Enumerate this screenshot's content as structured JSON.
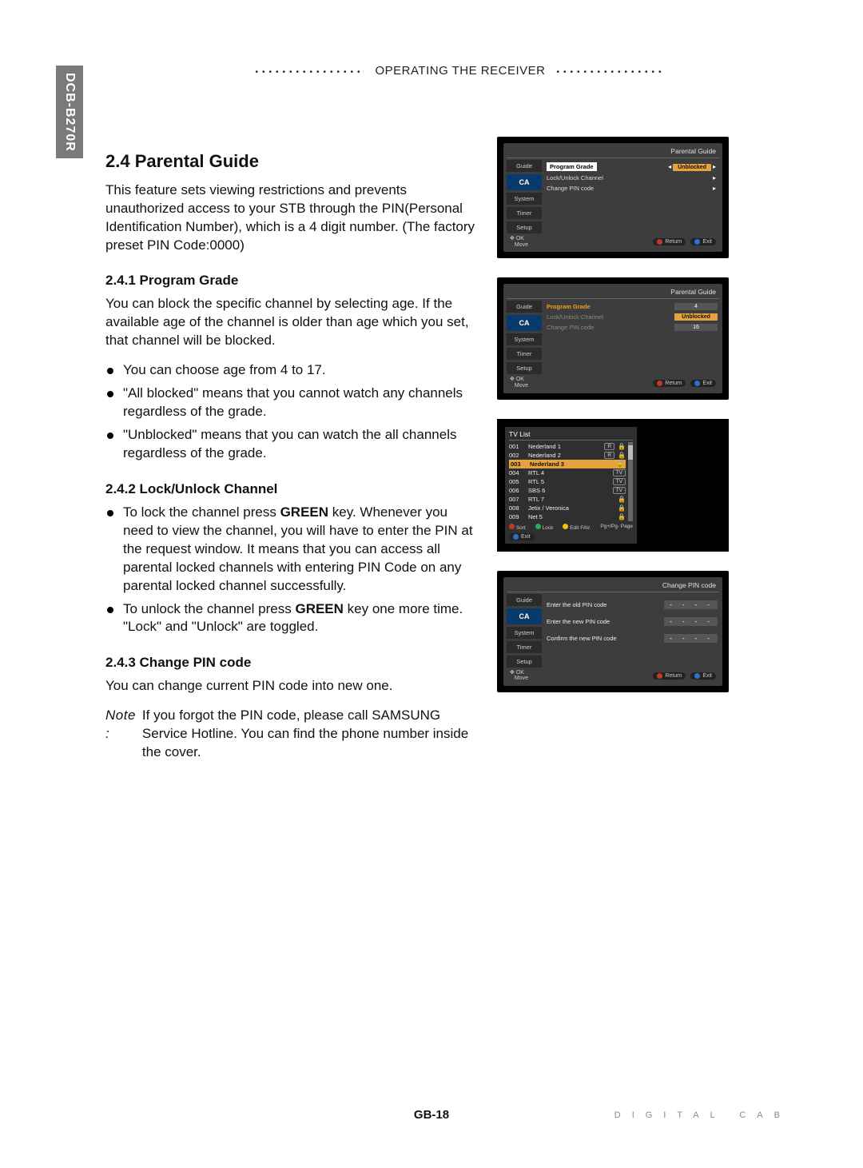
{
  "sideTab": "DCB-B270R",
  "headerTitle": "OPERATING THE RECEIVER",
  "section": {
    "title": "2.4 Parental Guide",
    "intro": "This feature sets viewing restrictions and prevents unauthorized access to your STB through the PIN(Personal Identification Number), which is a 4 digit number. (The factory preset PIN Code:0000)",
    "s1": {
      "title": "2.4.1 Program Grade",
      "p1": "You can block the specific channel by selecting age. If the available age of the channel is older than age which you set, that channel will be blocked.",
      "b1": "You can choose age from 4 to 17.",
      "b2": "\"All blocked\" means that you cannot watch any channels regardless of the grade.",
      "b3": "\"Unblocked\" means that you can watch the all channels regardless of the grade."
    },
    "s2": {
      "title": "2.4.2 Lock/Unlock Channel",
      "b1a": "To lock the channel press ",
      "b1key": "GREEN",
      "b1b": " key. Whenever you need to view the channel, you will have to enter the PIN at the request window. It means that you can access all parental locked channels with entering PIN Code on any parental locked channel successfully.",
      "b2a": "To unlock the channel press ",
      "b2key": "GREEN",
      "b2b": " key one more time. \"Lock\" and \"Unlock\" are toggled."
    },
    "s3": {
      "title": "2.4.3 Change PIN code",
      "p1": "You can change current PIN code into new one.",
      "noteLabel": "Note :",
      "noteText": "If you forgot the PIN code, please call SAMSUNG Service Hotline. You can find the phone number inside the cover."
    }
  },
  "footer": {
    "page": "GB-18",
    "brand": "DIGITAL CAB"
  },
  "shot1": {
    "title": "Parental Guide",
    "tabs": {
      "guide": "Guide",
      "ca": "CA",
      "system": "System",
      "timer": "Timer",
      "setup": "Setup"
    },
    "rows": {
      "r1l": "Program Grade",
      "r1v": "Unblocked",
      "r2l": "Lock/Unlock Channel",
      "r3l": "Change PIN code"
    },
    "ok": "OK",
    "move": "Move",
    "ret": "Return",
    "exit": "Exit"
  },
  "shot2": {
    "title": "Parental Guide",
    "rows": {
      "r1l": "Program Grade",
      "r1v": "4",
      "r2l": "Lock/Unlock Channel",
      "r2v": "Unblocked",
      "r3l": "Change PIN code",
      "r3v": "16"
    }
  },
  "shot3": {
    "title": "TV List",
    "rows": [
      {
        "n": "001",
        "name": "Nederland 1",
        "tag": "R",
        "lock": true
      },
      {
        "n": "002",
        "name": "Nederland 2",
        "tag": "R",
        "lock": true
      },
      {
        "n": "003",
        "name": "Nederland 3",
        "tag": "",
        "lock": true,
        "sel": true
      },
      {
        "n": "004",
        "name": "RTL 4",
        "tag": "TV",
        "lock": false
      },
      {
        "n": "005",
        "name": "RTL 5",
        "tag": "TV",
        "lock": false
      },
      {
        "n": "006",
        "name": "SBS 6",
        "tag": "TV",
        "lock": false
      },
      {
        "n": "007",
        "name": "RTL 7",
        "tag": "",
        "lock": true
      },
      {
        "n": "008",
        "name": "Jetix / Veronica",
        "tag": "",
        "lock": true
      },
      {
        "n": "009",
        "name": "Net 5",
        "tag": "",
        "lock": true
      }
    ],
    "sort": "Sort",
    "lock": "Lock",
    "edit": "Edit FAV.",
    "page": "Page",
    "exit": "Exit",
    "pginfo": "Pg+/Pg-"
  },
  "shot4": {
    "title": "Change PIN code",
    "r1": "Enter the old PIN code",
    "r2": "Enter the new PIN code",
    "r3": "Confirm the new PIN code",
    "mask": "- - - -"
  }
}
